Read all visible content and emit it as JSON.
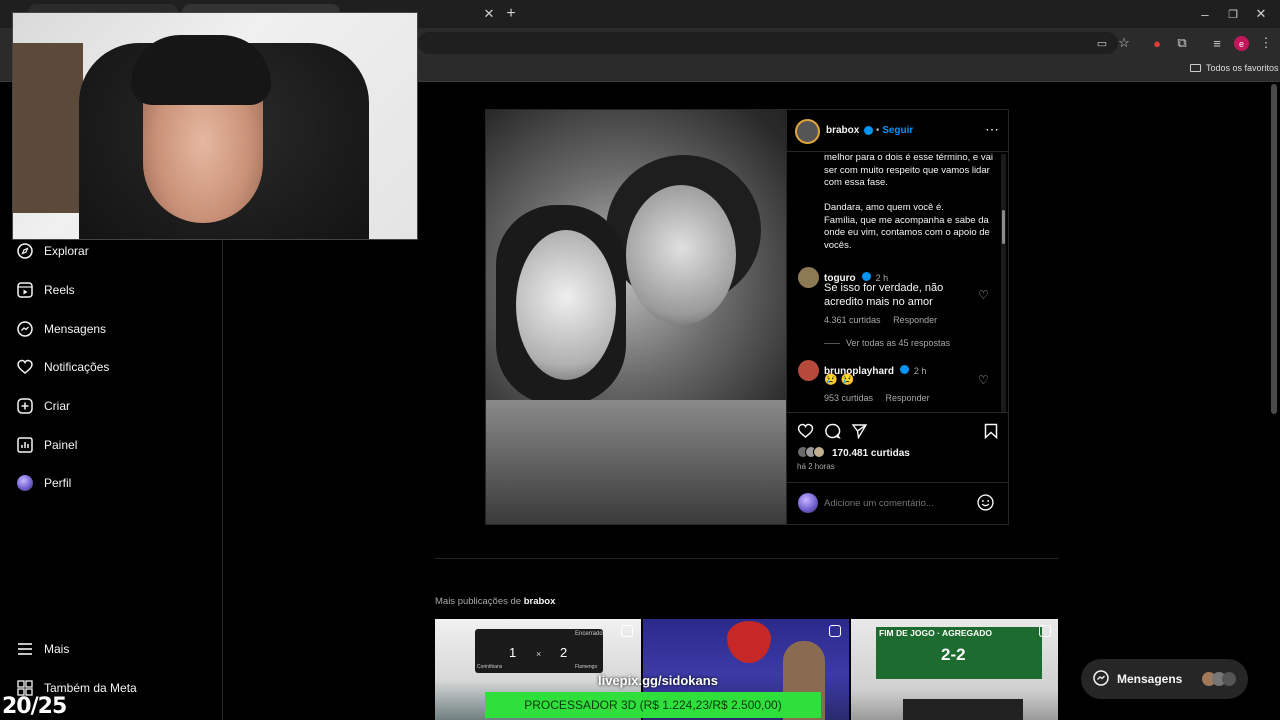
{
  "browser": {
    "bookmarks_label": "Todos os favoritos",
    "profile_initial": "e"
  },
  "sidebar": {
    "items": [
      {
        "label": "Explorar",
        "icon": "compass-icon"
      },
      {
        "label": "Reels",
        "icon": "reels-icon"
      },
      {
        "label": "Mensagens",
        "icon": "messenger-icon"
      },
      {
        "label": "Notificações",
        "icon": "heart-icon"
      },
      {
        "label": "Criar",
        "icon": "plus-square-icon"
      },
      {
        "label": "Painel",
        "icon": "dashboard-icon"
      },
      {
        "label": "Perfil",
        "icon": "avatar"
      }
    ],
    "more_label": "Mais",
    "meta_label": "Também da Meta"
  },
  "post": {
    "username": "brabox",
    "follow_label": "Seguir",
    "caption": [
      "melhor para o dois é esse término, e vai",
      "ser com muito respeito que vamos lidar",
      "com essa fase.",
      "",
      "Dandara, amo quem você é.",
      "Família, que me acompanha e sabe da",
      "onde eu vim, contamos com o apoio de",
      "vocês."
    ],
    "comments": [
      {
        "user": "toguro",
        "time": "2 h",
        "text": [
          "Se isso for verdade, não",
          "acredito mais no amor"
        ],
        "likes": "4.361 curtidas",
        "reply": "Responder",
        "view_replies": "Ver todas as 45 respostas"
      },
      {
        "user": "bruno​playhard",
        "time": "2 h",
        "text": [
          "😢 😢"
        ],
        "likes": "953 curtidas",
        "reply": "Responder"
      }
    ],
    "likes": "170.481 curtidas",
    "posted": "há 2 horas",
    "comment_placeholder": "Adicione um comentário..."
  },
  "more_posts": {
    "prefix": "Mais publicações de",
    "user": "brabox",
    "thumb1": {
      "left_team": "Corinthians",
      "right_team": "Flamengo",
      "score_left": "1",
      "score_right": "2",
      "sep": "×",
      "status": "Encerrado"
    },
    "thumb3": {
      "title": "FIM DE JOGO · AGREGADO",
      "score": "2-2"
    }
  },
  "overlay": {
    "livepix": "livepix.gg/sidokans",
    "donation": "PROCESSADOR 3D (R$ 1.224,23/R$ 2.500,00)",
    "donation_progress": 0.49,
    "counter": "20/25",
    "messages_label": "Mensagens"
  }
}
